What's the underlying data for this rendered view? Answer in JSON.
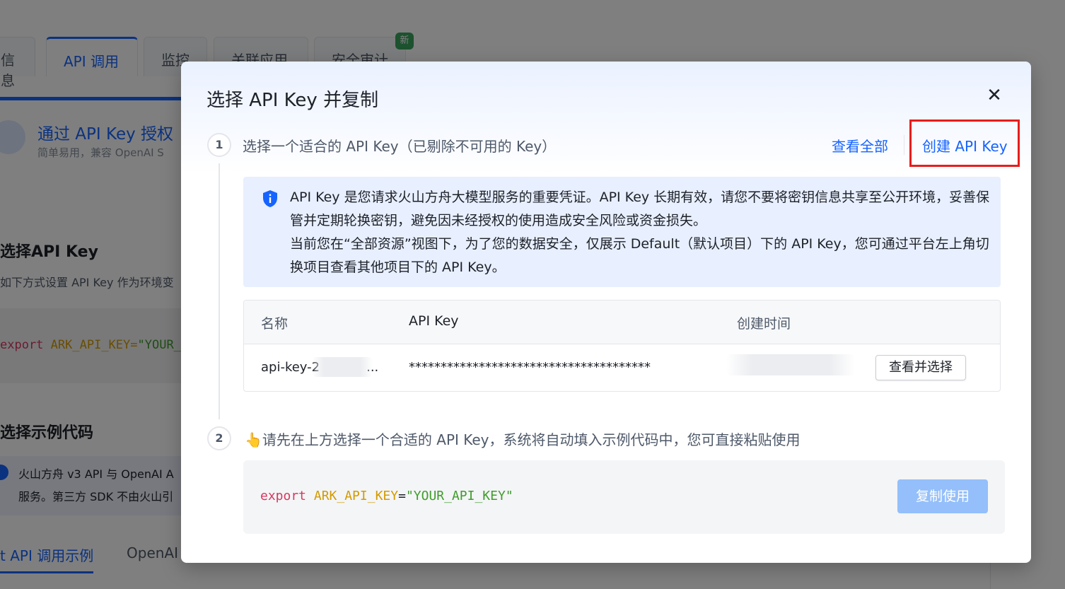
{
  "background": {
    "tabs": [
      "信息",
      "API 调用",
      "监控",
      "关联应用",
      "安全审计"
    ],
    "new_badge": "新",
    "auth_title": "通过 API Key 授权",
    "auth_sub": "简单易用，兼容 OpenAI S",
    "section1_title": "选择API Key",
    "section1_desc": "如下方式设置 API Key 作为环境变",
    "code_kw": "export",
    "code_var": "ARK_API_KEY=",
    "code_str": "\"YOUR_A",
    "section2_title": "选择示例代码",
    "info_line1": "火山方舟 v3 API 与 OpenAI A",
    "info_line2": "服务。第三方 SDK 不由火山引",
    "subtab1": "t API 调用示例",
    "subtab2": "OpenAI S"
  },
  "modal": {
    "title": "选择 API Key 并复制",
    "close": "✕",
    "step1": {
      "num": "1",
      "label": "选择一个适合的 API Key（已剔除不可用的 Key）",
      "view_all": "查看全部",
      "create": "创建 API Key"
    },
    "notice": {
      "line1": "API Key 是您请求火山方舟大模型服务的重要凭证。API Key 长期有效，请您不要将密钥信息共享至公开环境，妥善保管并定期轮换密钥，避免因未经授权的使用造成安全风险或资金损失。",
      "line2": "当前您在“全部资源”视图下，为了您的数据安全，仅展示 Default（默认项目）下的 API Key，您可通过平台左上角切换项目查看其他项目下的 API Key。"
    },
    "table": {
      "headers": [
        "名称",
        "API Key",
        "创建时间"
      ],
      "rows": [
        {
          "name": "api-key-2",
          "name_suffix": "...",
          "key": "**************************************",
          "action": "查看并选择"
        }
      ]
    },
    "step2": {
      "num": "2",
      "label": "👆请先在上方选择一个合适的 API Key，系统将自动填入示例代码中，您可直接粘贴使用"
    },
    "code": {
      "kw": "export",
      "var": "ARK_API_KEY",
      "op": "=",
      "str": "\"YOUR_API_KEY\""
    },
    "copy_button": "复制使用"
  }
}
